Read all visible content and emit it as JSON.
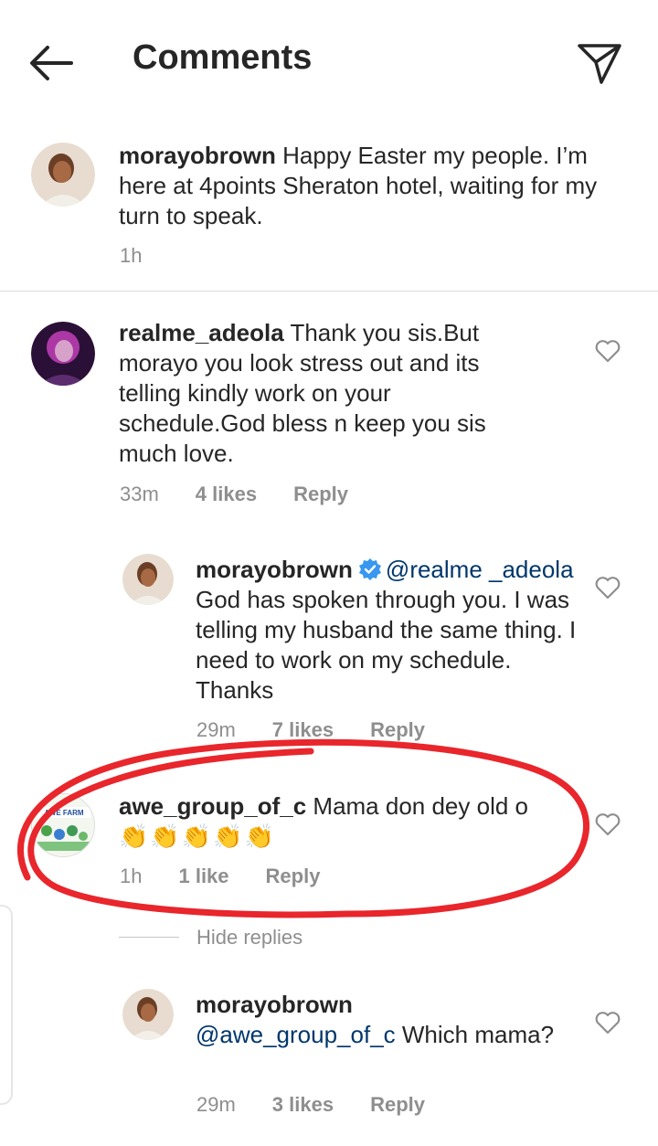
{
  "header": {
    "title": "Comments"
  },
  "caption": {
    "username": "morayobrown",
    "text": "Happy Easter my people. I’m here at 4points Sheraton hotel, waiting for my turn to speak.",
    "time": "1h"
  },
  "comments": [
    {
      "username": "realme_adeola",
      "text": "Thank you sis.But morayo you look stress out and its telling kindly work on your schedule.God bless n keep you sis much love.",
      "time": "33m",
      "likes": "4 likes",
      "reply": "Reply"
    },
    {
      "username": "morayobrown",
      "mention": "@realme _adeola",
      "text": "God has spoken through you. I was telling my husband the same thing. I need to work on my schedule. Thanks",
      "time": "29m",
      "likes": "7 likes",
      "reply": "Reply"
    },
    {
      "username": "awe_group_of_c",
      "text": "Mama don dey old o",
      "emojis": "👏👏👏👏👏",
      "time": "1h",
      "likes": "1 like",
      "reply": "Reply",
      "avatar_text": "AWE FARM"
    },
    {
      "username": "morayobrown",
      "mention": "@awe_group_of_c",
      "text": "Which mama?",
      "time": "29m",
      "likes": "3 likes",
      "reply": "Reply"
    }
  ],
  "hide_replies": "Hide replies",
  "colors": {
    "mention": "#00376b",
    "annotation": "#e8262b",
    "verified": "#3897f0"
  }
}
